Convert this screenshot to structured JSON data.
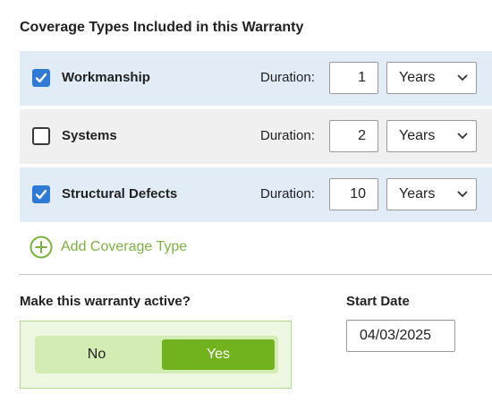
{
  "section_title": "Coverage Types Included in this Warranty",
  "coverage_types": [
    {
      "label": "Workmanship",
      "checked": true,
      "duration_label": "Duration:",
      "duration_value": "1",
      "unit": "Years"
    },
    {
      "label": "Systems",
      "checked": false,
      "duration_label": "Duration:",
      "duration_value": "2",
      "unit": "Years"
    },
    {
      "label": "Structural Defects",
      "checked": true,
      "duration_label": "Duration:",
      "duration_value": "10",
      "unit": "Years"
    }
  ],
  "add_coverage": {
    "label": "Add Coverage Type",
    "icon": "plus-circle-icon"
  },
  "active": {
    "question": "Make this warranty active?",
    "options": [
      "No",
      "Yes"
    ],
    "selected": "Yes"
  },
  "start_date": {
    "label": "Start Date",
    "value": "04/03/2025"
  },
  "colors": {
    "checked_row_bg": "#e2ecf6",
    "unchecked_row_bg": "#f0f0f0",
    "checkbox_blue": "#2f7ad6",
    "accent_green": "#7cb342",
    "toggle_selected_green": "#72b21f",
    "toggle_track_green": "#d2ecb4",
    "toggle_box_bg": "#eef7e2"
  }
}
